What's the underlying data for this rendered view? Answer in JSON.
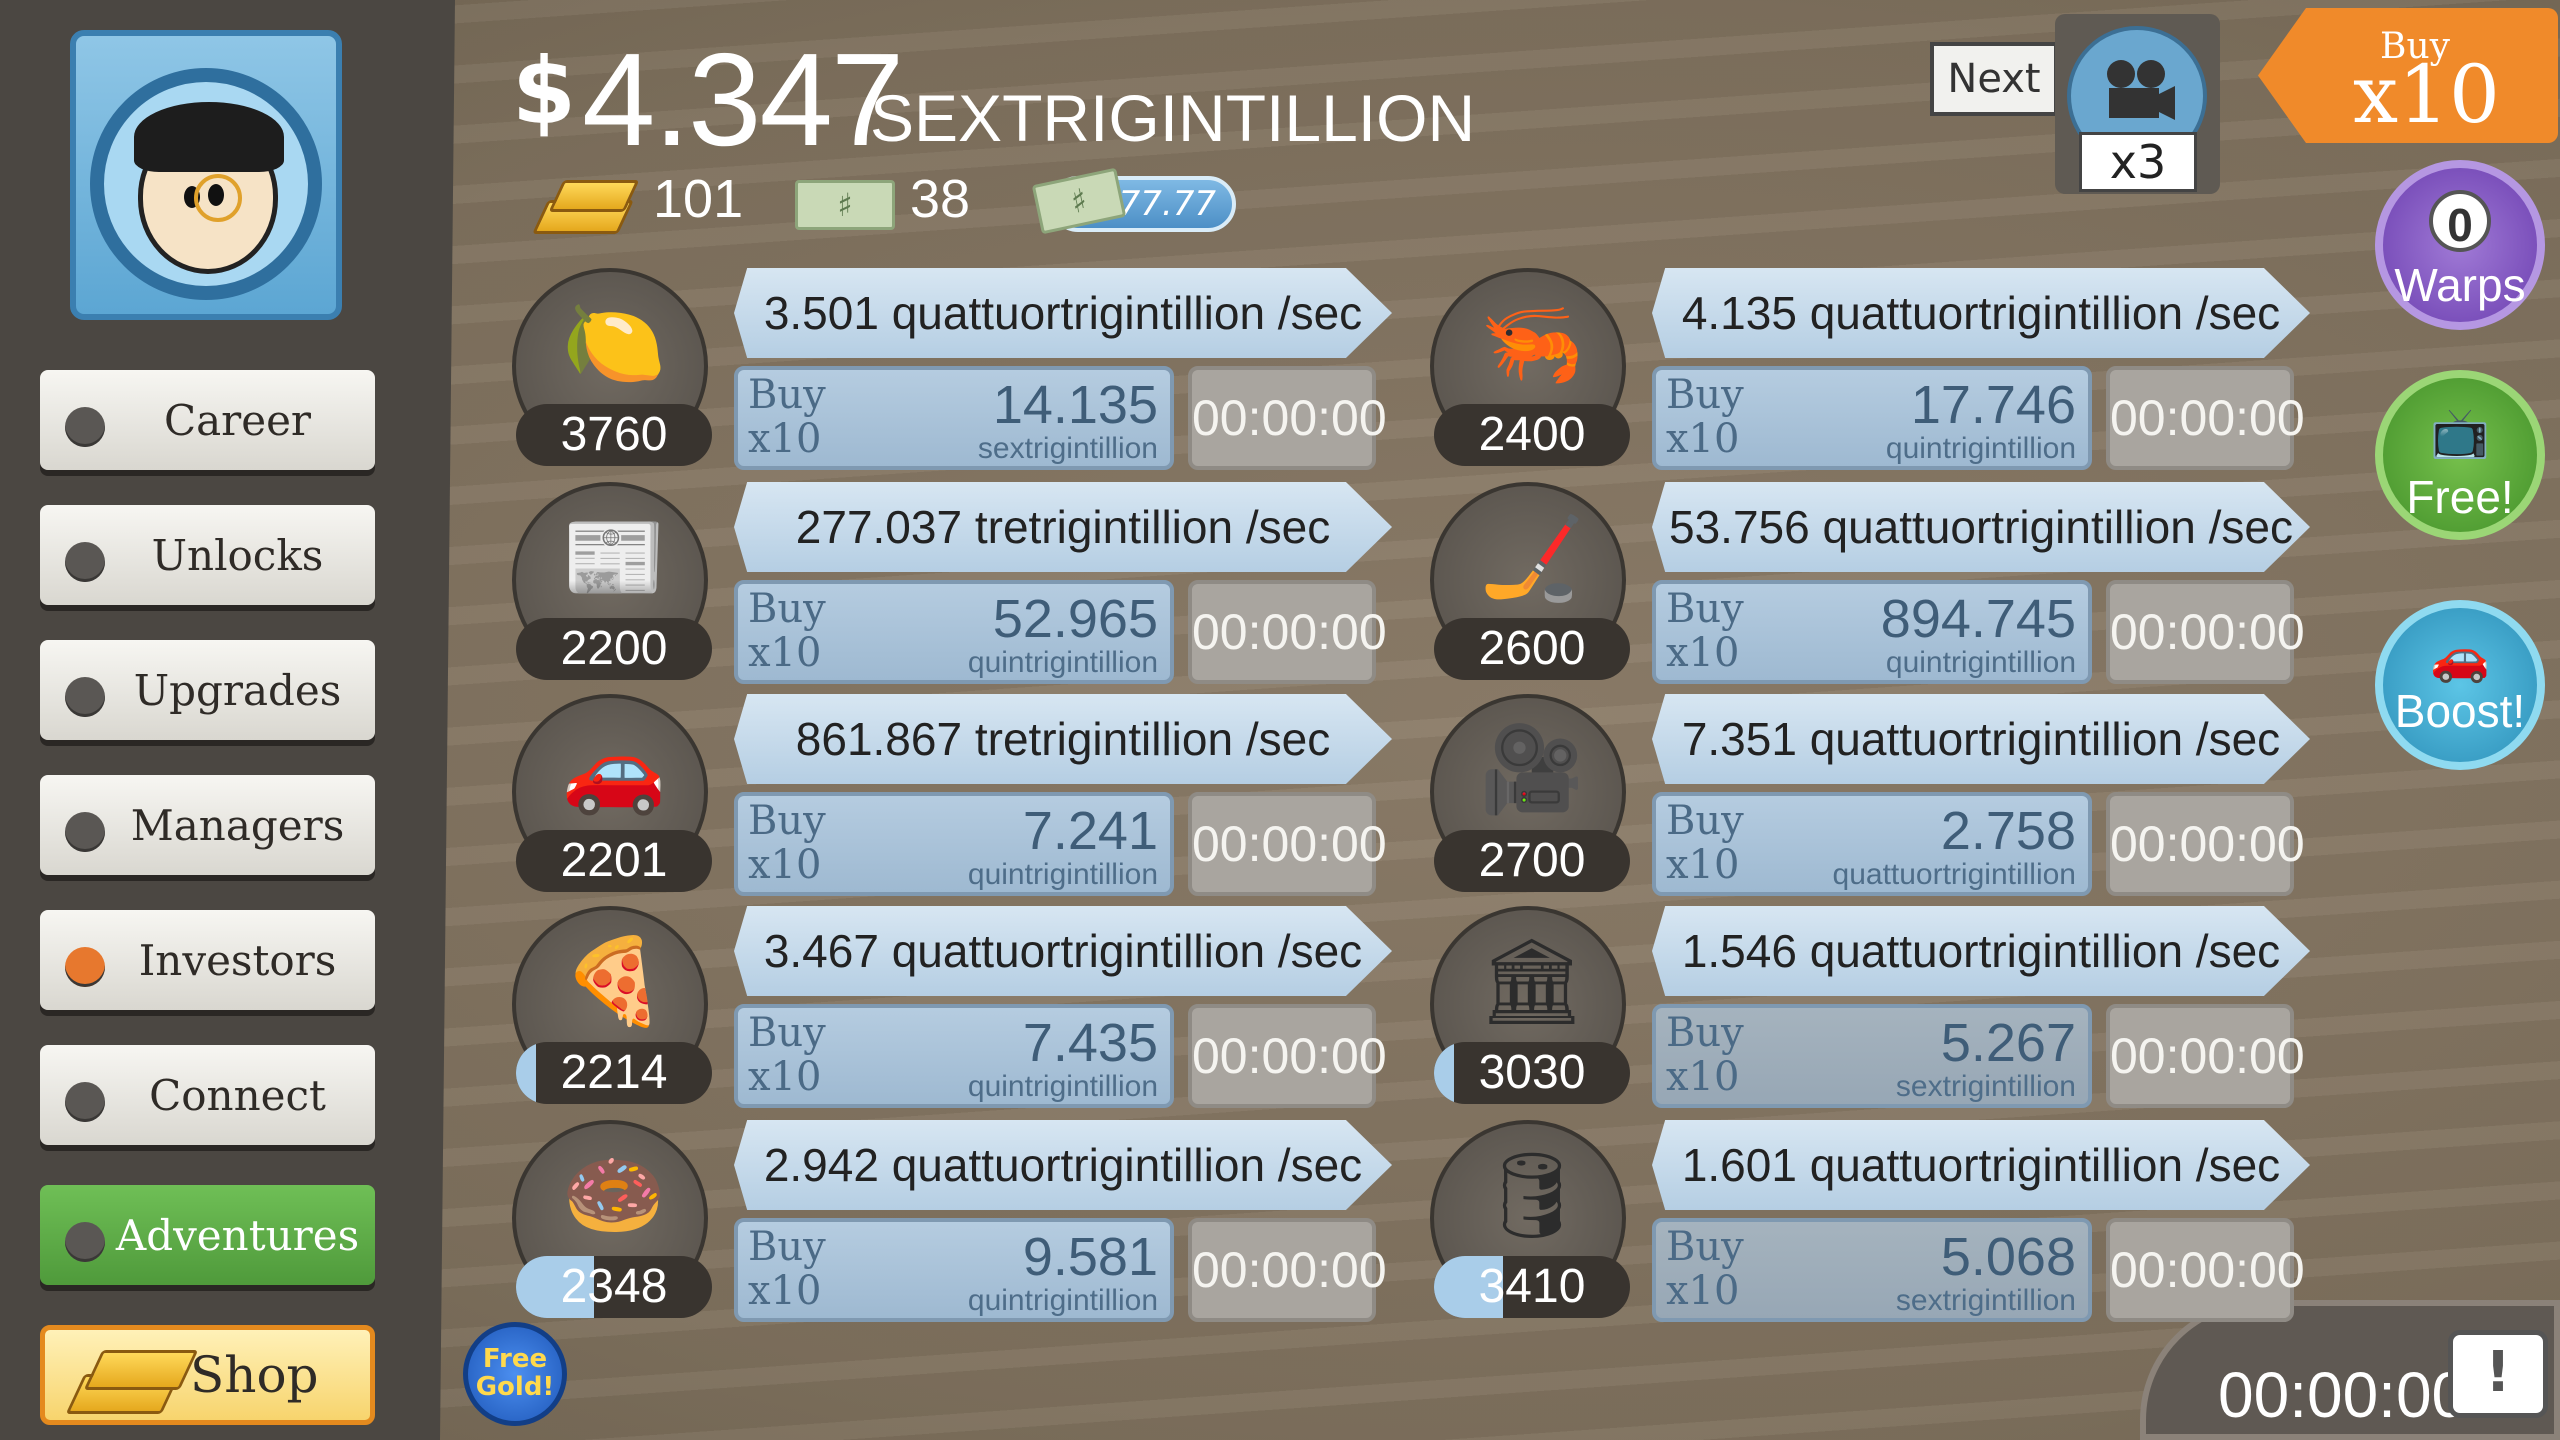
{
  "header": {
    "currency_symbol": "$",
    "money_value": "4.347",
    "money_unit": "SEXTRIGINTILLION",
    "gold_count": "101",
    "angel_count": "38",
    "angel_multiplier": "x777.77"
  },
  "top_right": {
    "next_label": "Next",
    "camera_multiplier": "x3",
    "buy_small": "Buy",
    "buy_big": "x10",
    "warps_count": "0",
    "warps_label": "Warps",
    "free_label": "Free!",
    "boost_label": "Boost!",
    "timer": "00:00:00"
  },
  "sidebar": {
    "items": [
      {
        "label": "Career"
      },
      {
        "label": "Unlocks"
      },
      {
        "label": "Upgrades"
      },
      {
        "label": "Managers"
      },
      {
        "label": "Investors"
      },
      {
        "label": "Connect"
      },
      {
        "label": "Adventures"
      }
    ],
    "shop_label": "Shop",
    "free_gold_label": "Free Gold!"
  },
  "businesses": [
    {
      "icon": "lemon-icon",
      "count": "3760",
      "progress": 0,
      "rate": "3.501 quattuortrigintillion /sec",
      "buy_top": "Buy",
      "buy_bottom": "x10",
      "cost": "14.135",
      "cost_unit": "sextrigintillion",
      "timer": "00:00:00"
    },
    {
      "icon": "newspaper-icon",
      "count": "2200",
      "progress": 0,
      "rate": "277.037 tretrigintillion /sec",
      "buy_top": "Buy",
      "buy_bottom": "x10",
      "cost": "52.965",
      "cost_unit": "quintrigintillion",
      "timer": "00:00:00"
    },
    {
      "icon": "car-wash-icon",
      "count": "2201",
      "progress": 0,
      "rate": "861.867 tretrigintillion /sec",
      "buy_top": "Buy",
      "buy_bottom": "x10",
      "cost": "7.241",
      "cost_unit": "quintrigintillion",
      "timer": "00:00:00"
    },
    {
      "icon": "pizza-icon",
      "count": "2214",
      "progress": 0.1,
      "rate": "3.467 quattuortrigintillion /sec",
      "buy_top": "Buy",
      "buy_bottom": "x10",
      "cost": "7.435",
      "cost_unit": "quintrigintillion",
      "timer": "00:00:00"
    },
    {
      "icon": "donut-icon",
      "count": "2348",
      "progress": 0.4,
      "rate": "2.942 quattuortrigintillion /sec",
      "buy_top": "Buy",
      "buy_bottom": "x10",
      "cost": "9.581",
      "cost_unit": "quintrigintillion",
      "timer": "00:00:00"
    },
    {
      "icon": "shrimp-icon",
      "count": "2400",
      "progress": 0,
      "rate": "4.135 quattuortrigintillion /sec",
      "buy_top": "Buy",
      "buy_bottom": "x10",
      "cost": "17.746",
      "cost_unit": "quintrigintillion",
      "timer": "00:00:00"
    },
    {
      "icon": "hockey-icon",
      "count": "2600",
      "progress": 0,
      "rate": "53.756 quattuortrigintillion /sec",
      "buy_top": "Buy",
      "buy_bottom": "x10",
      "cost": "894.745",
      "cost_unit": "quintrigintillion",
      "timer": "00:00:00"
    },
    {
      "icon": "movie-camera-icon",
      "count": "2700",
      "progress": 0,
      "rate": "7.351 quattuortrigintillion /sec",
      "buy_top": "Buy",
      "buy_bottom": "x10",
      "cost": "2.758",
      "cost_unit": "quattuortrigintillion",
      "timer": "00:00:00"
    },
    {
      "icon": "bank-icon",
      "count": "3030",
      "progress": 0.1,
      "rate": "1.546 quattuortrigintillion /sec",
      "buy_top": "Buy",
      "buy_bottom": "x10",
      "cost": "5.267",
      "cost_unit": "sextrigintillion",
      "timer": "00:00:00"
    },
    {
      "icon": "oil-rig-icon",
      "count": "3410",
      "progress": 0.35,
      "rate": "1.601 quattuortrigintillion /sec",
      "buy_top": "Buy",
      "buy_bottom": "x10",
      "cost": "5.068",
      "cost_unit": "sextrigintillion",
      "timer": "00:00:00"
    }
  ]
}
